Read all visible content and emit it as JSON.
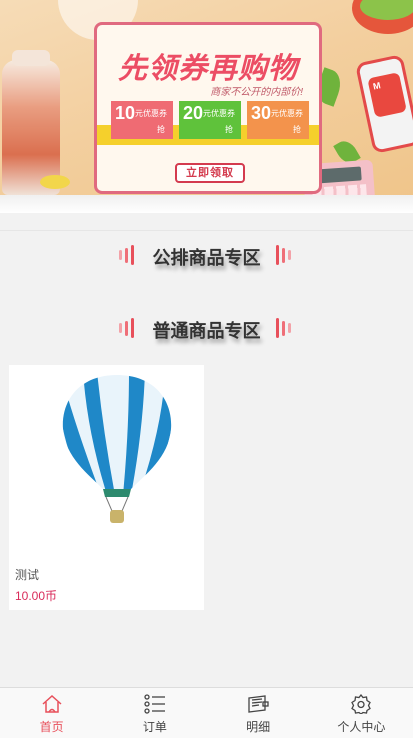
{
  "banner": {
    "title": "先领券再购物",
    "subtitle": "商家不公开的内部价!",
    "coupons": [
      {
        "amount": "10",
        "text": "元优惠券",
        "action": "抢"
      },
      {
        "amount": "20",
        "text": "元优惠券",
        "action": "抢"
      },
      {
        "amount": "30",
        "text": "元优惠券",
        "action": "抢"
      }
    ],
    "claim_label": "立即领取",
    "phone_badge": "M"
  },
  "sections": {
    "featured_title": "公排商品专区",
    "normal_title": "普通商品专区"
  },
  "products": [
    {
      "name": "测试",
      "price": "10.00币"
    }
  ],
  "tabbar": {
    "items": [
      {
        "label": "首页",
        "icon": "home-icon",
        "active": true
      },
      {
        "label": "订单",
        "icon": "list-icon",
        "active": false
      },
      {
        "label": "明细",
        "icon": "receipt-icon",
        "active": false
      },
      {
        "label": "个人中心",
        "icon": "settings-icon",
        "active": false
      }
    ]
  },
  "colors": {
    "accent": "#e8505b",
    "price": "#d92b5a",
    "banner_title": "#ec4d64"
  }
}
